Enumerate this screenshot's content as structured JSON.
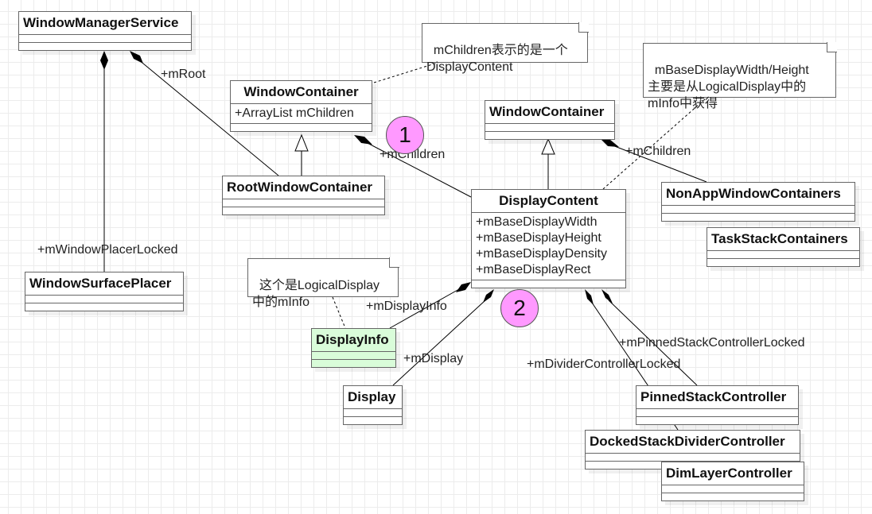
{
  "classes": {
    "wms": {
      "name": "WindowManagerService"
    },
    "wc1": {
      "name": "WindowContainer",
      "attrs": "+ArrayList mChildren"
    },
    "rwc": {
      "name": "RootWindowContainer"
    },
    "wsp": {
      "name": "WindowSurfacePlacer"
    },
    "wc2": {
      "name": "WindowContainer"
    },
    "dc": {
      "name": "DisplayContent",
      "attrs": [
        "+mBaseDisplayWidth",
        "+mBaseDisplayHeight",
        "+mBaseDisplayDensity",
        "+mBaseDisplayRect"
      ]
    },
    "nawc": {
      "name": "NonAppWindowContainers"
    },
    "tsc": {
      "name": "TaskStackContainers"
    },
    "di": {
      "name": "DisplayInfo"
    },
    "disp": {
      "name": "Display"
    },
    "psc": {
      "name": "PinnedStackController"
    },
    "dsdc": {
      "name": "DockedStackDividerController"
    },
    "dlc": {
      "name": "DimLayerController"
    }
  },
  "notes": {
    "n1": "mChildren表示的是一个\nDisplayContent",
    "n2": "mBaseDisplayWidth/Height\n主要是从LogicalDisplay中的\nmInfo中获得",
    "n3": "这个是LogicalDisplay\n中的mInfo"
  },
  "labels": {
    "mRoot": "+mRoot",
    "mWindowPlacerLocked": "+mWindowPlacerLocked",
    "mChildren1": "+mChildren",
    "mChildren2": "+mChildren",
    "mDisplayInfo": "+mDisplayInfo",
    "mDisplay": "+mDisplay",
    "mPinned": "+mPinnedStackControllerLocked",
    "mDivider": "+mDividerControllerLocked"
  },
  "markers": {
    "m1": "1",
    "m2": "2"
  },
  "colors": {
    "marker": "#ff99ff",
    "displayinfo": "#d9fcd9",
    "border": "#666666"
  }
}
